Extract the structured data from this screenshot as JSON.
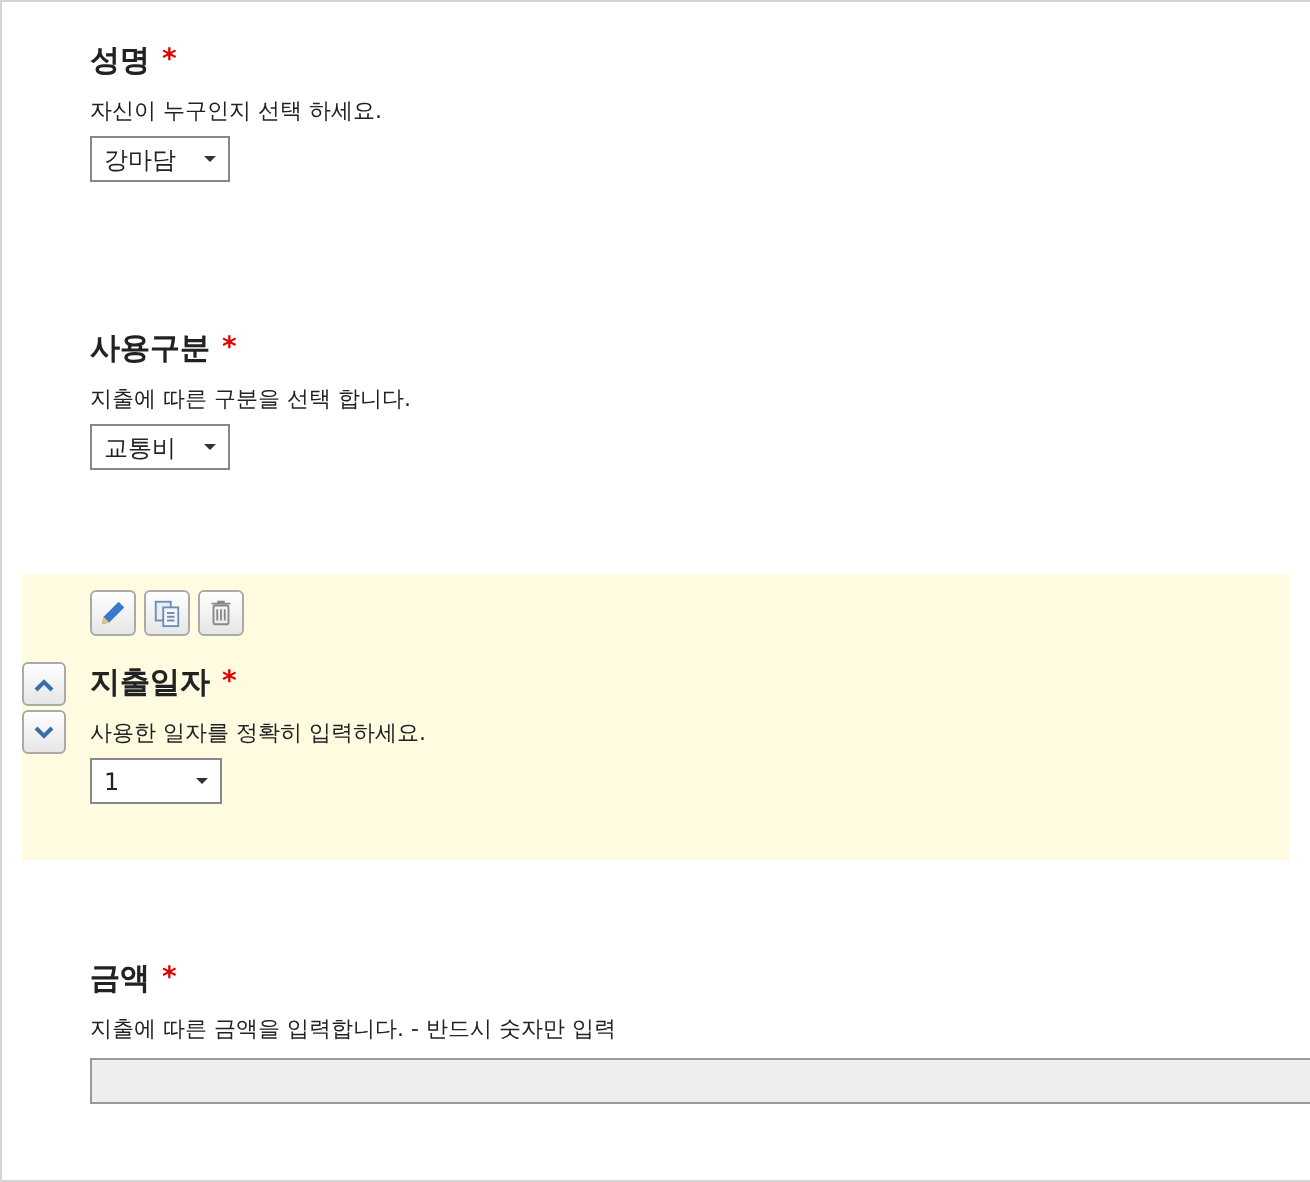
{
  "fields": [
    {
      "kind": "select",
      "label": "성명",
      "required_mark": "*",
      "description": "자신이 누구인지 선택 하세요.",
      "value": "강마담",
      "selected": false
    },
    {
      "kind": "select",
      "label": "사용구분",
      "required_mark": "*",
      "description": "지출에 따른 구분을 선택 합니다.",
      "value": "교통비",
      "selected": false
    },
    {
      "kind": "select",
      "label": "지출일자",
      "required_mark": "*",
      "description": "사용한 일자를 정확히 입력하세요.",
      "value": "1",
      "selected": true
    },
    {
      "kind": "text",
      "label": "금액",
      "required_mark": "*",
      "description": "지출에 따른 금액을 입력합니다. - 반드시 숫자만 입력",
      "disabled": true,
      "selected": false
    }
  ]
}
